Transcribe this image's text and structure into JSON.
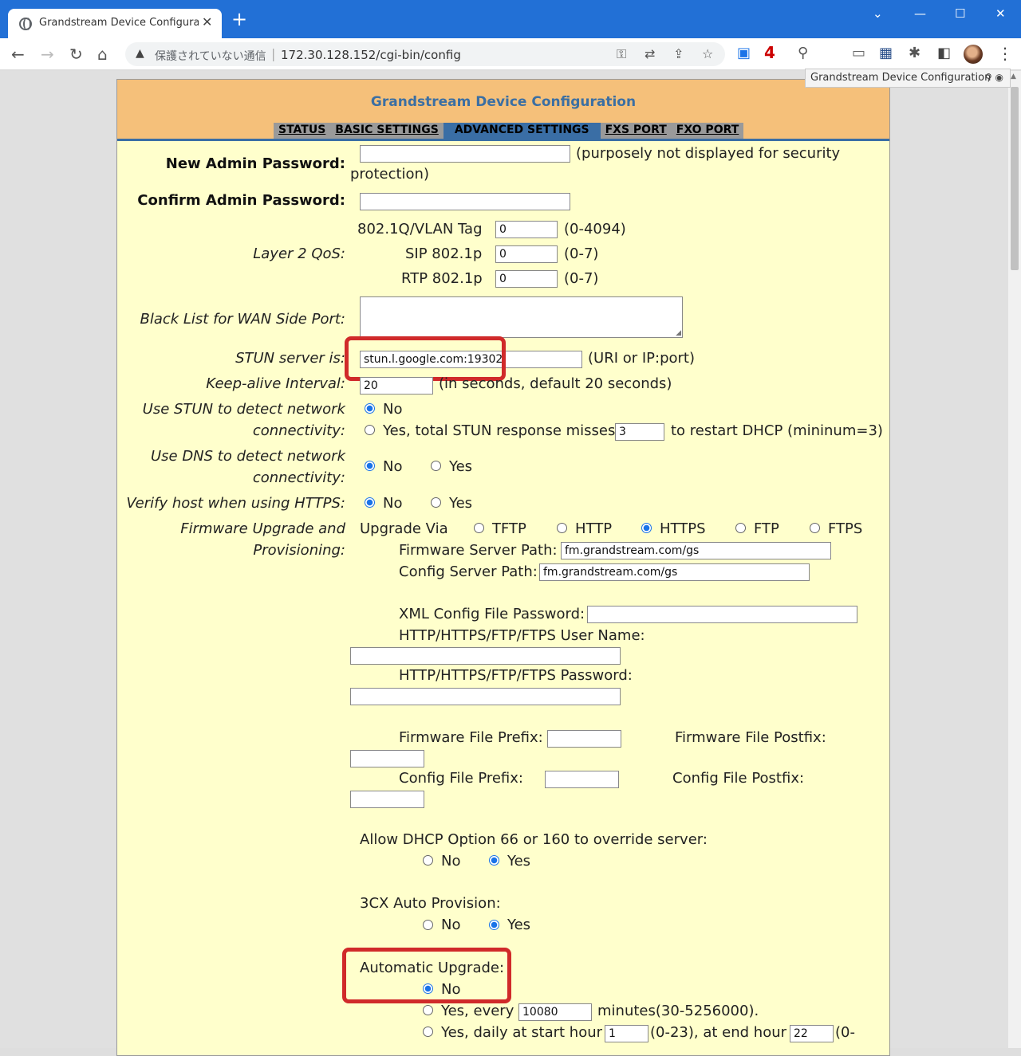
{
  "browser": {
    "tab_title": "Grandstream Device Configuration",
    "tab_close": "✕",
    "new_tab": "+",
    "security_text": "保護されていない通信",
    "url": "172.30.128.152/cgi-bin/config",
    "url_separator": "|",
    "hover_tooltip": "Grandstream Device Configuration",
    "extension_badge": "4"
  },
  "header": {
    "title": "Grandstream Device Configuration",
    "tabs": [
      "STATUS",
      "BASIC SETTINGS",
      "ADVANCED SETTINGS",
      "FXS PORT",
      "FXO PORT"
    ],
    "active_tab": "ADVANCED SETTINGS"
  },
  "admin": {
    "new_password_label": "New Admin Password:",
    "new_password_note": "(purposely not displayed for security",
    "new_password_note2": "protection)",
    "confirm_password_label": "Confirm Admin Password:"
  },
  "qos": {
    "label": "Layer 2 QoS:",
    "vlan_label": "802.1Q/VLAN Tag",
    "vlan_value": "0",
    "vlan_range": "(0-4094)",
    "sip_label": "SIP 802.1p",
    "sip_value": "0",
    "sip_range": "(0-7)",
    "rtp_label": "RTP 802.1p",
    "rtp_value": "0",
    "rtp_range": "(0-7)"
  },
  "blacklist": {
    "label": "Black List for WAN Side Port:"
  },
  "stun": {
    "label": "STUN server is:",
    "value": "stun.l.google.com:19302",
    "note": "(URI or IP:port)"
  },
  "keepalive": {
    "label": "Keep-alive Interval:",
    "value": "20",
    "note": "(in seconds, default 20 seconds)"
  },
  "use_stun": {
    "label1": "Use STUN to detect network",
    "label2": "connectivity:",
    "no": "No",
    "yes": "Yes, total STUN response misses",
    "misses_value": "3",
    "suffix": "to restart DHCP (mininum=3)"
  },
  "use_dns": {
    "label1": "Use DNS to detect network",
    "label2": "connectivity:",
    "no": "No",
    "yes": "Yes"
  },
  "verify_host": {
    "label": "Verify host when using HTTPS:",
    "no": "No",
    "yes": "Yes"
  },
  "firmware": {
    "label1": "Firmware Upgrade and",
    "label2": "Provisioning:",
    "upgrade_via": "Upgrade Via",
    "options": [
      "TFTP",
      "HTTP",
      "HTTPS",
      "FTP",
      "FTPS"
    ],
    "selected": "HTTPS",
    "fw_server_label": "Firmware Server Path:",
    "fw_server_value": "fm.grandstream.com/gs",
    "cfg_server_label": "Config Server Path:",
    "cfg_server_value": "fm.grandstream.com/gs",
    "xml_password_label": "XML Config File Password:",
    "user_name_label": "HTTP/HTTPS/FTP/FTPS User Name:",
    "password_label": "HTTP/HTTPS/FTP/FTPS Password:",
    "fw_prefix_label": "Firmware File Prefix:",
    "fw_postfix_label": "Firmware File Postfix:",
    "cfg_prefix_label": "Config File Prefix:",
    "cfg_postfix_label": "Config File Postfix:"
  },
  "dhcp66": {
    "label": "Allow DHCP Option 66 or 160 to override server:",
    "no": "No",
    "yes": "Yes"
  },
  "auto3cx": {
    "label": "3CX Auto Provision:",
    "no": "No",
    "yes": "Yes"
  },
  "auto_upgrade": {
    "label": "Automatic Upgrade:",
    "no": "No",
    "yes_every": "Yes, every",
    "every_value": "10080",
    "every_suffix": "minutes(30-5256000).",
    "yes_daily": "Yes, daily at start hour",
    "start_value": "1",
    "start_range": "(0-23), at end hour",
    "end_value": "22",
    "end_suffix": "(0-"
  },
  "colors": {
    "page_bg": "#ffffcc",
    "header_bg": "#f5c07a",
    "title": "#3b6fa3",
    "active_tab": "#3a6ea5",
    "highlight": "#d02a2a",
    "browser_tabbar": "#2270d6"
  }
}
